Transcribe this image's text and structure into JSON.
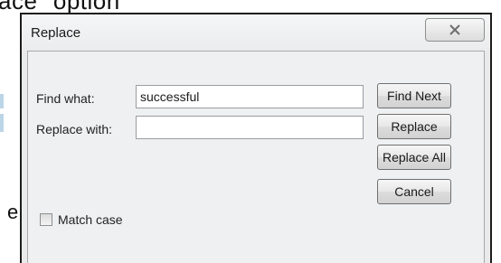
{
  "background": {
    "top_cropped_text": "ace\" option",
    "left_cropped_text": "e"
  },
  "dialog": {
    "title": "Replace"
  },
  "find": {
    "label": "Find what:",
    "value": "successful",
    "placeholder": ""
  },
  "replace": {
    "label": "Replace with:",
    "value": "",
    "placeholder": ""
  },
  "buttons": {
    "find_next": "Find Next",
    "replace": "Replace",
    "replace_all": "Replace All",
    "cancel": "Cancel"
  },
  "match_case": {
    "label": "Match case",
    "checked": false
  },
  "icons": {
    "close": "close-icon"
  }
}
